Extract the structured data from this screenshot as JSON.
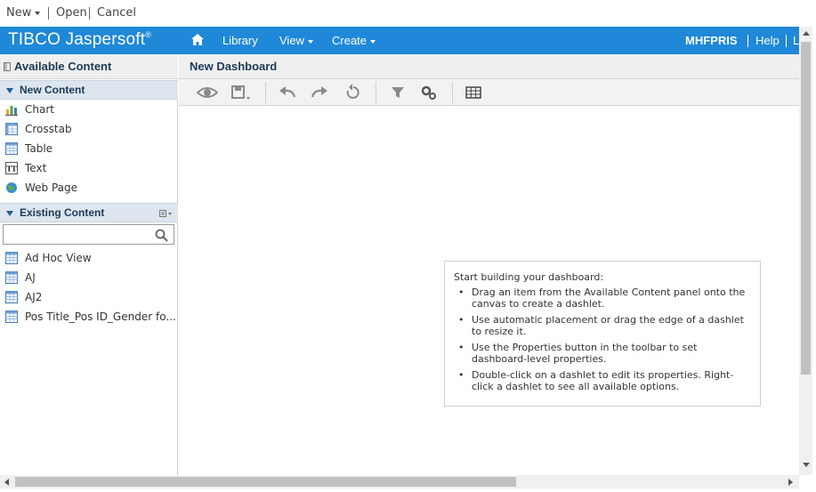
{
  "window_menu": {
    "new": "New",
    "open": "Open",
    "cancel": "Cancel"
  },
  "header": {
    "brand": "TIBCO Jaspersoft",
    "brand_mark": "®",
    "nav": {
      "home_icon": "home-icon",
      "library": "Library",
      "view": "View",
      "create": "Create"
    },
    "user": "MHFPRIS",
    "help": "Help",
    "logout": "L"
  },
  "left_panel": {
    "title": "Available Content",
    "new_content": {
      "title": "New Content",
      "items": [
        {
          "label": "Chart",
          "icon": "chart-icon"
        },
        {
          "label": "Crosstab",
          "icon": "crosstab-icon"
        },
        {
          "label": "Table",
          "icon": "table-icon"
        },
        {
          "label": "Text",
          "icon": "text-icon"
        },
        {
          "label": "Web Page",
          "icon": "globe-icon"
        }
      ]
    },
    "existing_content": {
      "title": "Existing Content",
      "search_placeholder": "",
      "items": [
        {
          "label": "Ad Hoc View"
        },
        {
          "label": "AJ"
        },
        {
          "label": "AJ2"
        },
        {
          "label": "Pos Title_Pos ID_Gender fo..."
        }
      ]
    }
  },
  "main": {
    "title": "New Dashboard",
    "toolbar": [
      "preview-icon",
      "save-icon",
      "undo-icon",
      "redo-icon",
      "undo-all-icon",
      "filter-icon",
      "properties-icon",
      "grid-icon"
    ],
    "help": {
      "intro": "Start building your dashboard:",
      "tips": [
        "Drag an item from the Available Content panel onto the canvas to create a dashlet.",
        "Use automatic placement or drag the edge of a dashlet to resize it.",
        "Use the Properties button in the toolbar to set dashboard-level properties.",
        "Double-click on a dashlet to edit its properties. Right-click a dashlet to see all available options."
      ]
    }
  },
  "colors": {
    "header_bg": "#1f88d8",
    "section_bg": "#dde6ee",
    "title_text": "#1c3a57"
  }
}
